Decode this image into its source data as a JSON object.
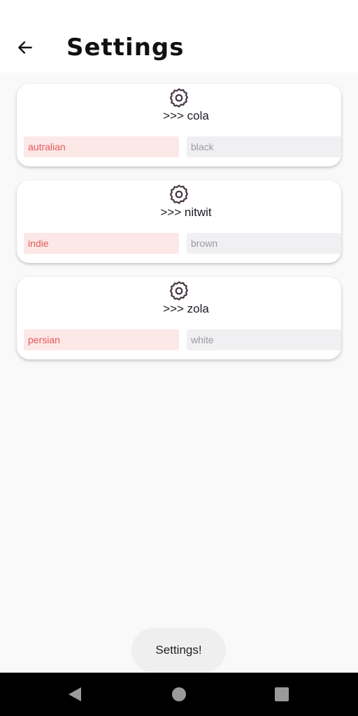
{
  "header": {
    "title": "Settings"
  },
  "cards": [
    {
      "name": ">>> cola",
      "breed": "autralian",
      "color": "black"
    },
    {
      "name": ">>> nitwit",
      "breed": "indie",
      "color": "brown"
    },
    {
      "name": ">>> zola",
      "breed": "persian",
      "color": "white"
    }
  ],
  "toast": {
    "text": "Settings!"
  },
  "icons": {
    "back": "arrow-left-icon",
    "card": "gear-icon",
    "nav": [
      "triangle-back-icon",
      "circle-home-icon",
      "square-recents-icon"
    ]
  },
  "colors": {
    "icon": "#4a3a46",
    "breed_text": "#e45858",
    "breed_bg": "#fde8e8",
    "color_text": "#9a9aa2",
    "color_bg": "#f0f0f2"
  }
}
